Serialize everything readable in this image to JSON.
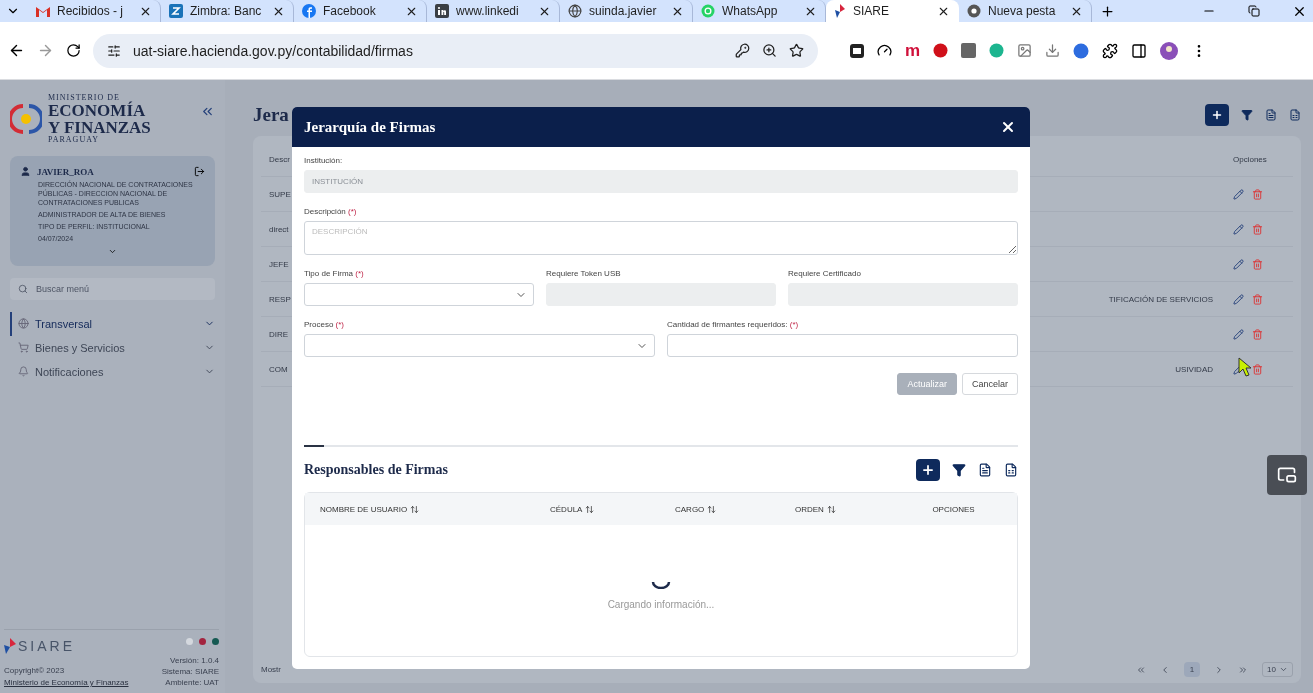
{
  "browser": {
    "tabs": [
      {
        "title": "Recibidos - j",
        "kind": "mail",
        "selected": false
      },
      {
        "title": "Zimbra: Banc",
        "kind": "zimbra",
        "selected": false
      },
      {
        "title": "Facebook",
        "kind": "facebook",
        "selected": false
      },
      {
        "title": "www.linkedi",
        "kind": "linkedin",
        "selected": false
      },
      {
        "title": "suinda.javier",
        "kind": "globe",
        "selected": false
      },
      {
        "title": "WhatsApp",
        "kind": "whatsapp",
        "selected": false
      },
      {
        "title": "SIARE",
        "kind": "siare",
        "selected": true
      },
      {
        "title": "Nueva pesta",
        "kind": "chrome",
        "selected": false
      }
    ],
    "url": "uat-siare.hacienda.gov.py/contabilidad/firmas",
    "extension_letter": "m"
  },
  "sidebar": {
    "logo": {
      "top": "MINISTERIO DE",
      "line1": "ECONOMÍA",
      "line2": "Y FINANZAS",
      "bottom": "PARAGUAY"
    },
    "user": {
      "name": "JAVIER_ROA",
      "details": [
        "DIRECCIÓN NACIONAL DE CONTRATACIONES PÚBLICAS - DIRECCION NACIONAL DE CONTRATACIONES PUBLICAS",
        "ADMINISTRADOR DE ALTA DE BIENES",
        "TIPO DE PERFIL: INSTITUCIONAL",
        "04/07/2024"
      ]
    },
    "search": {
      "placeholder": "Buscar menú"
    },
    "menu": [
      {
        "label": "Transversal",
        "kind": "globe",
        "selected": true
      },
      {
        "label": "Bienes y Servicios",
        "kind": "cart",
        "selected": false
      },
      {
        "label": "Notificaciones",
        "kind": "bell",
        "selected": false
      }
    ],
    "footer": {
      "brand": "SIARE",
      "copyright": "Copyright© 2023",
      "link": "Ministerio de Economía y Finanzas",
      "themes": [
        {
          "color": "#d4d8de"
        },
        {
          "color": "#a3243f"
        },
        {
          "color": "#165a53"
        }
      ],
      "version": "Versión: 1.0.4",
      "system": "Sistema: SIARE",
      "environment": "Ambiente: UAT"
    }
  },
  "page": {
    "title": "Jera",
    "table": {
      "columns": [
        "Descr",
        "Opciones"
      ],
      "rows": [
        {
          "description": "SUPE"
        },
        {
          "description": "direct"
        },
        {
          "description": "JEFE"
        },
        {
          "description": "RESP",
          "detail": "TIFICACIÓN DE SERVICIOS"
        },
        {
          "description": "DIRE"
        },
        {
          "description": "COM",
          "detail": "USIVIDAD"
        }
      ]
    },
    "footer_text": "Mostr",
    "pagination": {
      "current": "1",
      "page_size": "10"
    }
  },
  "modal": {
    "title": "Jerarquía de Firmas",
    "rows": [
      [
        {
          "label": "Institución:",
          "kind": "input",
          "disabled": true,
          "placeholder": "INSTITUCIÓN"
        }
      ],
      [
        {
          "label": "Descripción",
          "required_mark": "(*)",
          "kind": "textarea",
          "disabled": false,
          "placeholder": "DESCRIPCIÓN"
        }
      ],
      [
        {
          "label": "Tipo de Firma",
          "required_mark": "(*)",
          "kind": "select",
          "disabled": false
        },
        {
          "label": "Requiere Token USB",
          "kind": "input",
          "disabled": true
        },
        {
          "label": "Requiere Certificado",
          "kind": "input",
          "disabled": true
        }
      ],
      [
        {
          "label": "Proceso",
          "required_mark": "(*)",
          "kind": "select",
          "disabled": false
        },
        {
          "label": "Cantidad de firmantes requeridos:",
          "required_mark": "(*)",
          "kind": "input",
          "disabled": false
        }
      ]
    ],
    "buttons": [
      {
        "label": "Actualizar",
        "kind": "primary",
        "disabled": true
      },
      {
        "label": "Cancelar",
        "kind": "secondary",
        "disabled": false
      }
    ],
    "section": {
      "title": "Responsables de Firmas",
      "columns": [
        {
          "label": "NOMBRE DE USUARIO",
          "sortable": true
        },
        {
          "label": "CÉDULA",
          "sortable": true
        },
        {
          "label": "CARGO",
          "sortable": true
        },
        {
          "label": "ORDEN",
          "sortable": true
        },
        {
          "label": "OPCIONES",
          "sortable": false
        }
      ],
      "loading_text": "Cargando información..."
    }
  }
}
